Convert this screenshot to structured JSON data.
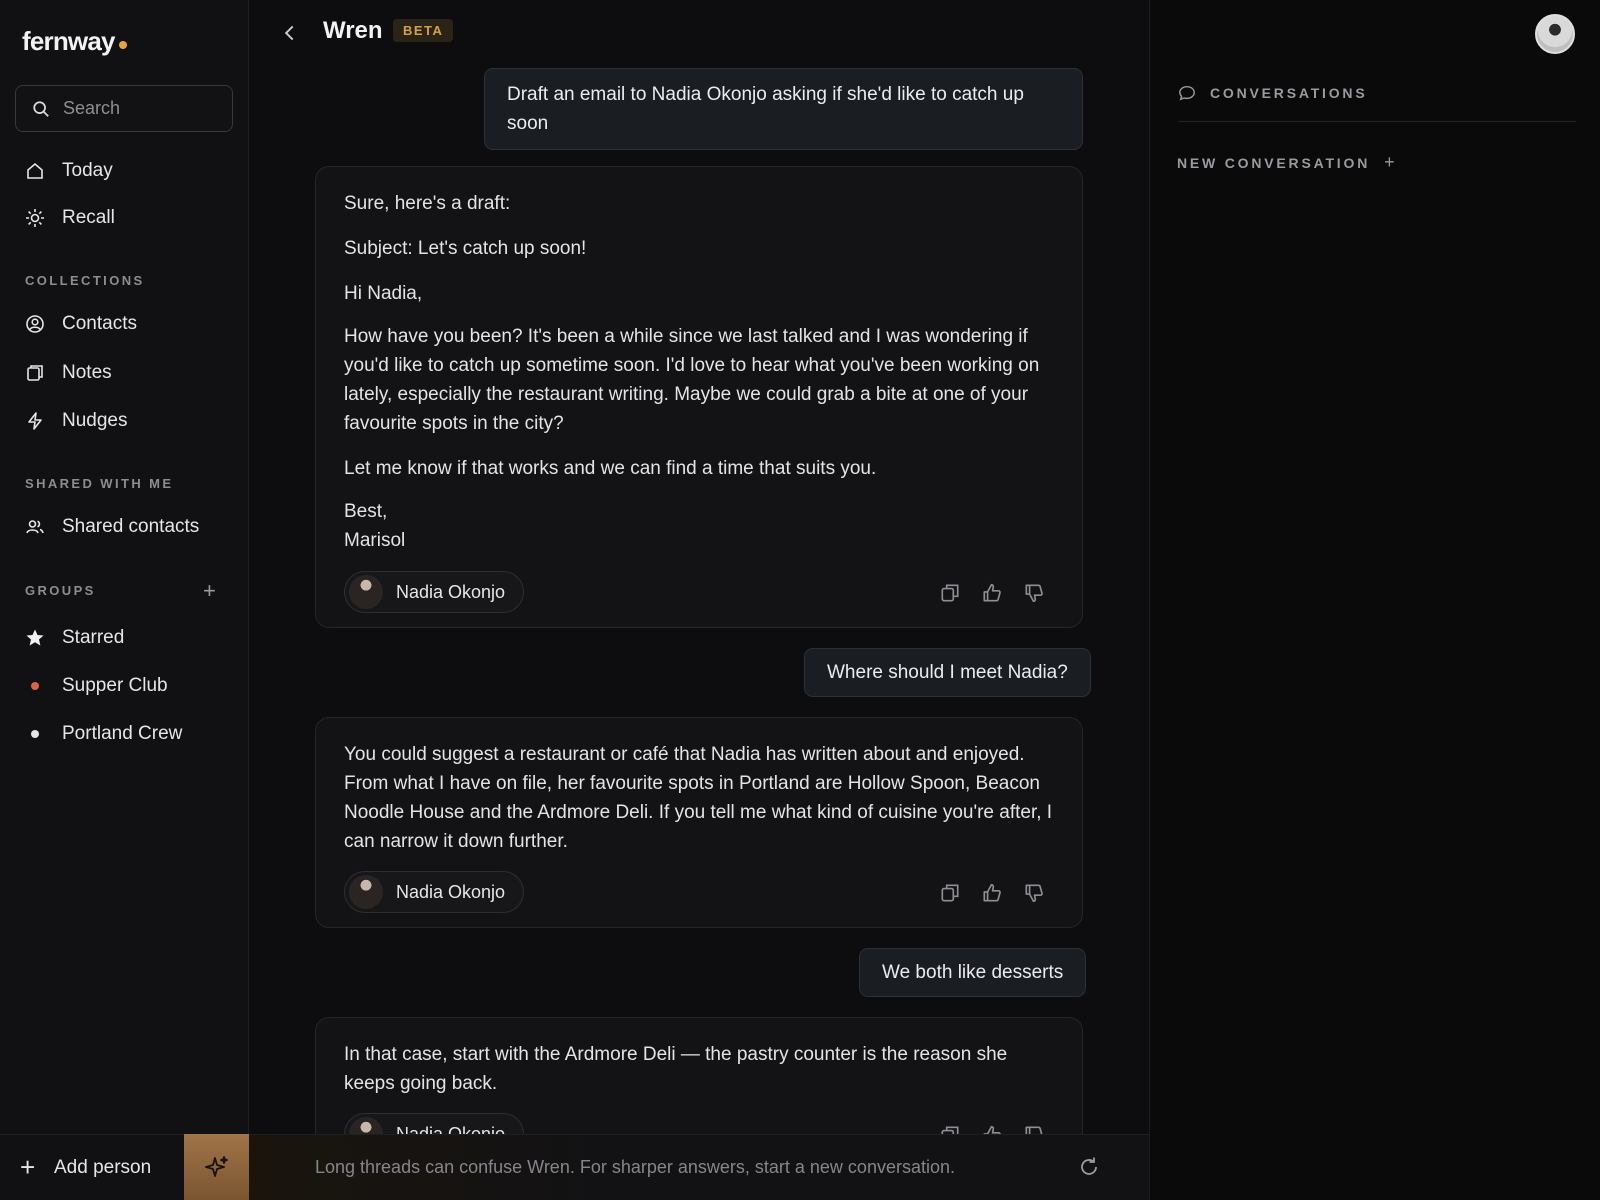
{
  "brand": {
    "name": "fernway",
    "dot_color": "#e8a43a"
  },
  "search": {
    "label": "Search"
  },
  "nav": {
    "today": "Today",
    "recall": "Recall"
  },
  "collections": {
    "heading": "COLLECTIONS",
    "items": [
      "Contacts",
      "Notes",
      "Nudges"
    ]
  },
  "shared": {
    "heading": "SHARED WITH ME",
    "items": [
      "Shared contacts"
    ]
  },
  "groups": {
    "heading": "GROUPS",
    "add": "+",
    "items": [
      {
        "label": "Starred",
        "icon": "star-icon"
      },
      {
        "label": "Supper Club",
        "dot_color": "#e0604a"
      },
      {
        "label": "Portland Crew",
        "dot_color": "#e6e6e8"
      }
    ]
  },
  "bottom": {
    "add_person": "Add person",
    "hint": "Long threads can confuse Wren. For sharper answers, start a new conversation."
  },
  "header": {
    "title": "Wren",
    "badge": "BETA"
  },
  "messages": {
    "user1": "Draft an email to Nadia Okonjo asking if she'd like to catch up soon",
    "reply1": {
      "lines": [
        "Sure, here's a draft:",
        "Subject: Let's catch up soon!",
        "Hi Nadia,",
        "How have you been? It's been a while since we last talked and I was wondering if you'd like to catch up sometime soon. I'd love to hear what you've been working on lately, especially the restaurant writing. Maybe we could grab a bite at one of your favourite spots in the city?",
        "Let me know if that works and we can find a time that suits you.",
        "Best,",
        "Marisol"
      ],
      "contact": "Nadia Okonjo"
    },
    "user2": "Where should I meet Nadia?",
    "reply2": {
      "text": "You could suggest a restaurant or café that Nadia has written about and enjoyed. From what I have on file, her favourite spots in Portland are Hollow Spoon, Beacon Noodle House and the Ardmore Deli. If you tell me what kind of cuisine you're after, I can narrow it down further.",
      "contact": "Nadia Okonjo"
    },
    "user3": "We both like desserts",
    "reply3": {
      "text": "In that case, start with the Ardmore Deli — the pastry counter is the reason she keeps going back.",
      "contact": "Nadia Okonjo"
    }
  },
  "right_panel": {
    "conversations": "CONVERSATIONS",
    "new_conversation": "NEW CONVERSATION",
    "new_plus": "+"
  }
}
